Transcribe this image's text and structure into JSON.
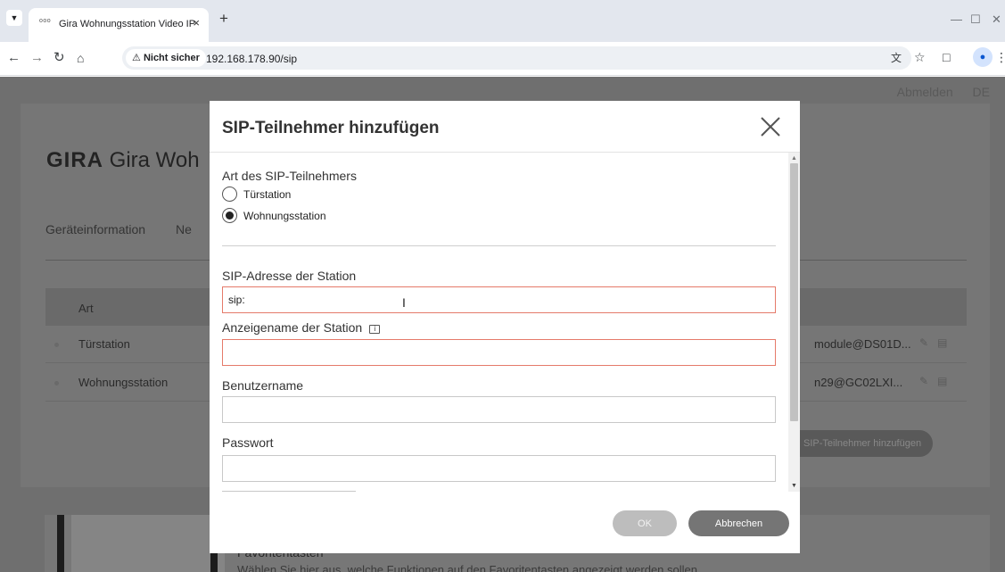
{
  "browser": {
    "tab_title": "Gira Wohnungsstation Video IP",
    "tab_favicon": "ooo",
    "tab_close": "×",
    "new_tab": "+",
    "security_label": "Nicht sicher",
    "url": "192.168.178.90/sip",
    "icons": [
      "tab-menu-icon",
      "back-icon",
      "forward-icon",
      "reload-icon",
      "home-icon",
      "warning-icon",
      "translate-icon",
      "star-icon",
      "extensions-icon",
      "profile-icon",
      "menu-icon"
    ]
  },
  "page": {
    "logout": "Abmelden",
    "language": "DE",
    "logo_brand": "GIRA",
    "logo_text": "Gira Woh",
    "tabs": [
      "Geräteinformation",
      "Ne"
    ],
    "table": {
      "header_art": "Art",
      "rows": [
        {
          "art": "Türstation",
          "address": "module@DS01D..."
        },
        {
          "art": "Wohnungsstation",
          "address": "n29@GC02LXI..."
        }
      ]
    },
    "add_button": "SIP-Teilnehmer hinzufügen",
    "bottom_title": "Favoritentasten",
    "bottom_text": "Wählen Sie hier aus, welche Funktionen auf den Favoritentasten angezeigt werden sollen."
  },
  "modal": {
    "title": "SIP-Teilnehmer hinzufügen",
    "type_label": "Art des SIP-Teilnehmers",
    "options": [
      {
        "label": "Türstation",
        "checked": false
      },
      {
        "label": "Wohnungsstation",
        "checked": true
      }
    ],
    "sip_address_label": "SIP-Adresse der Station",
    "sip_address_value": "sip:",
    "display_name_label": "Anzeigename der Station",
    "display_name_value": "",
    "username_label": "Benutzername",
    "username_value": "",
    "password_label": "Passwort",
    "password_value": "",
    "ok_label": "OK",
    "cancel_label": "Abbrechen"
  }
}
